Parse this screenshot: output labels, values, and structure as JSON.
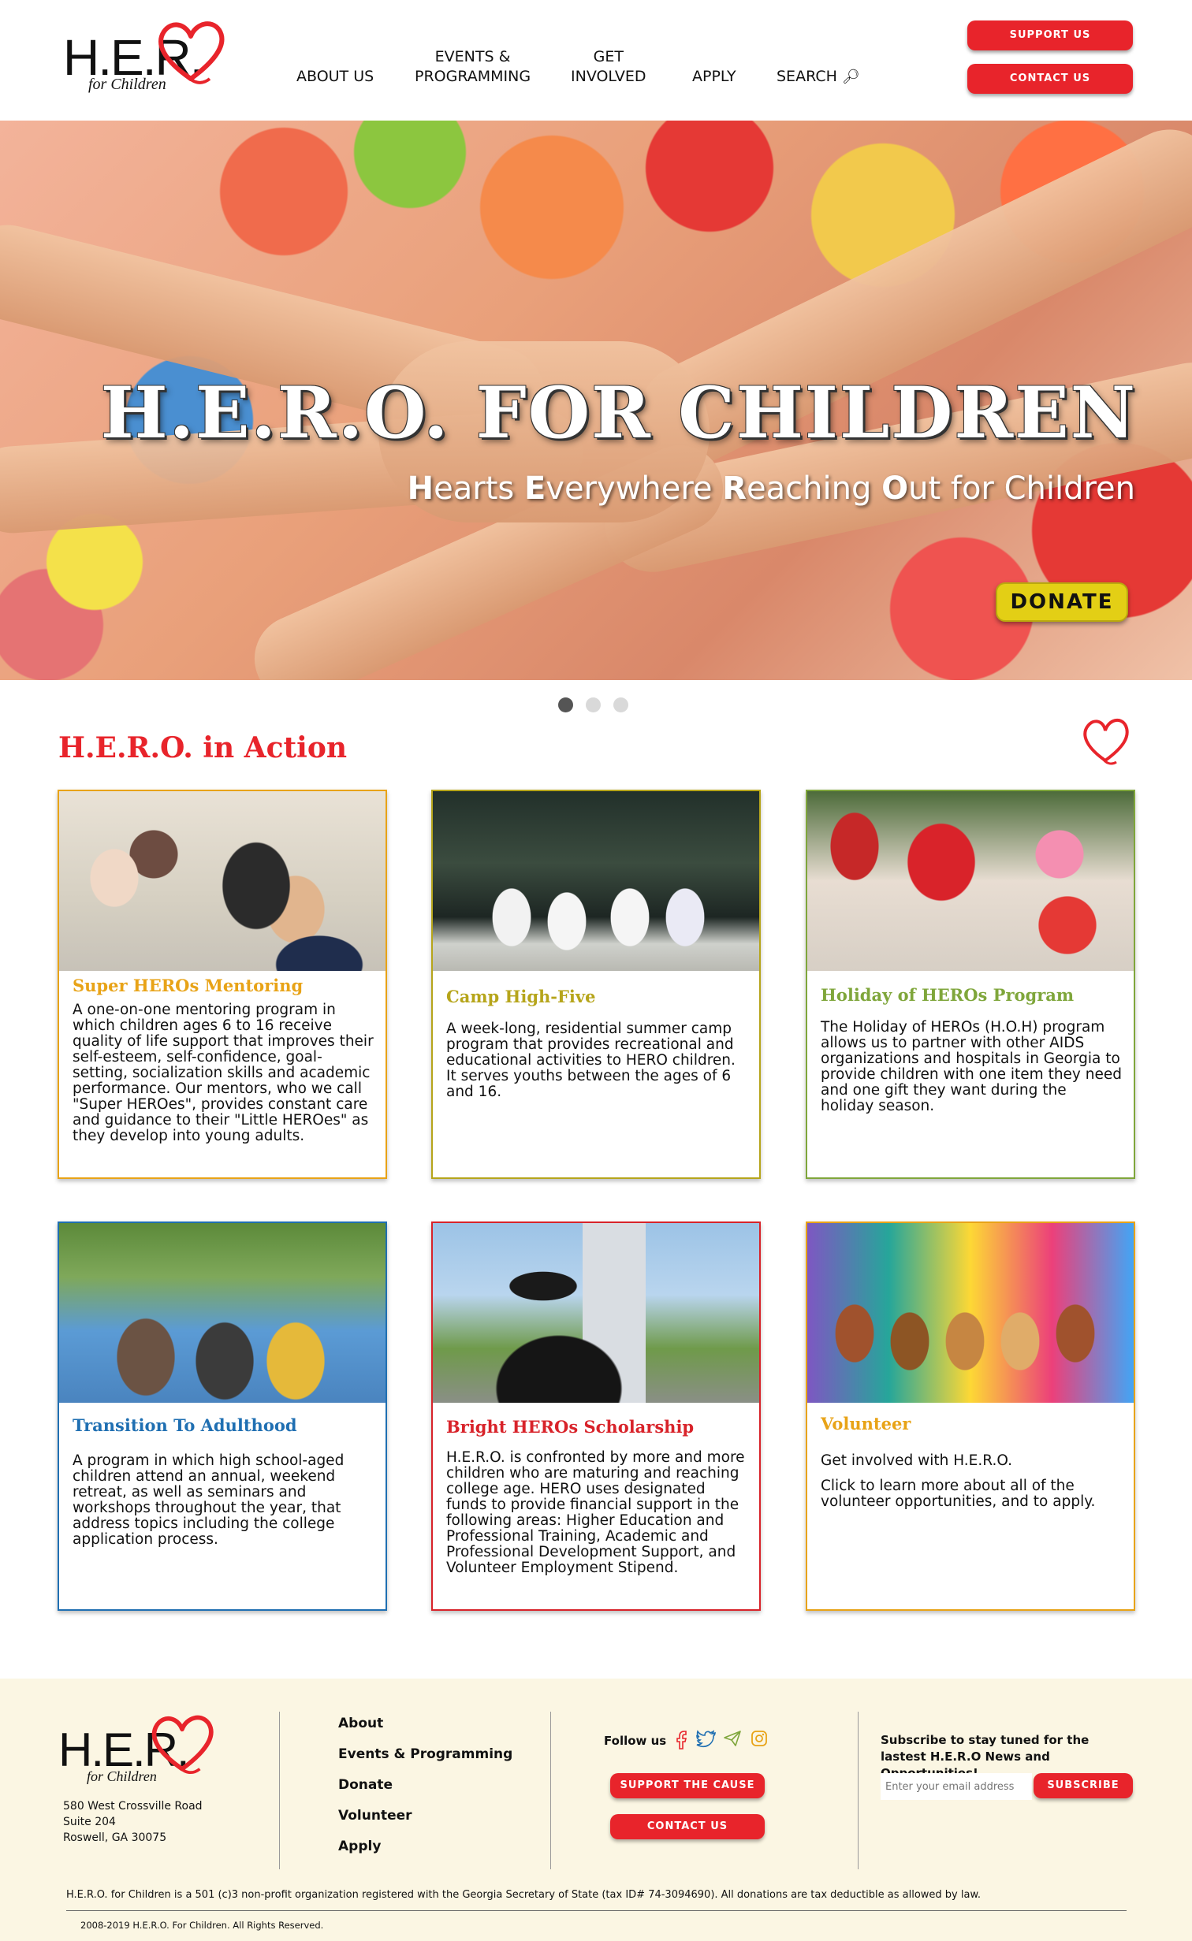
{
  "header": {
    "logo_text": "H.E.R.",
    "logo_sub": "for Children",
    "nav": [
      {
        "line1": "",
        "line2": "ABOUT US"
      },
      {
        "line1": "EVENTS &",
        "line2": "PROGRAMMING"
      },
      {
        "line1": "GET",
        "line2": "INVOLVED"
      },
      {
        "line1": "",
        "line2": "APPLY"
      },
      {
        "line1": "",
        "line2": "SEARCH"
      }
    ],
    "support_label": "SUPPORT US",
    "contact_label": "CONTACT US"
  },
  "hero": {
    "title": "H.E.R.O. FOR CHILDREN",
    "subtitle_parts": [
      {
        "initial": "H",
        "rest": "earts "
      },
      {
        "initial": "E",
        "rest": "verywhere "
      },
      {
        "initial": "R",
        "rest": "eaching "
      },
      {
        "initial": "O",
        "rest": "ut for Children"
      }
    ],
    "donate_label": "DONATE",
    "active_slide": 1,
    "slide_count": 3
  },
  "section": {
    "title": "H.E.R.O. in Action"
  },
  "cards": [
    {
      "title": "Super HEROs Mentoring",
      "color": "#e8a317",
      "text": "A one-on-one mentoring program in which children ages 6 to 16 receive quality of life support that improves their self-esteem, self-confidence, goal-setting, socialization skills and academic performance. Our mentors, who we call \"Super HEROes\", provides constant care and guidance to their \"Little HEROes\" as they develop into young adults."
    },
    {
      "title": "Camp High-Five",
      "color": "#b6a51b",
      "text": "A week-long, residential summer camp program that provides recreational and educational activities to HERO children. It serves youths between the ages of 6 and 16."
    },
    {
      "title": "Holiday of HEROs Program",
      "color": "#7fa63b",
      "text": "The Holiday of HEROs (H.O.H) program allows us to partner with other AIDS organizations and hospitals in Georgia to provide children with one item they need and one gift they want during the holiday season."
    },
    {
      "title": "Transition To Adulthood",
      "color": "#1f6fb2",
      "text": "A program in which high school-aged children attend an annual, weekend retreat, as well as seminars and workshops throughout the year, that address topics including the college application process."
    },
    {
      "title": "Bright HEROs Scholarship",
      "color": "#d8232a",
      "text": "H.E.R.O. is confronted by more and more children who are maturing and reaching college age. HERO uses designated funds to provide financial support in the following areas: Higher Education and Professional Training, Academic and Professional Development Support, and Volunteer Employment Stipend."
    },
    {
      "title": "Volunteer",
      "color": "#e8a317",
      "text": "Get involved with H.E.R.O.",
      "text2": "Click to learn more about all of the volunteer opportunities, and to apply."
    }
  ],
  "footer": {
    "logo_text": "H.E.R.",
    "logo_sub": "for Children",
    "address": [
      "580 West Crossville Road",
      "Suite 204",
      "Roswell, GA 30075"
    ],
    "links": [
      "About",
      "Events & Programming",
      "Donate",
      "Volunteer",
      "Apply"
    ],
    "follow_label": "Follow us",
    "support_cause_label": "SUPPORT THE CAUSE",
    "contact_label": "CONTACT US",
    "subscribe_text": "Subscribe to stay tuned for the lastest H.E.R.O News and Opportunities!",
    "email_placeholder": "Enter your email address",
    "subscribe_label": "SUBSCRIBE",
    "legal": "H.E.R.O. for Children is a 501 (c)3 non-profit organization registered with the Georgia Secretary of State (tax ID# 74-3094690). All donations are tax deductible as allowed by law.",
    "copyright": "2008-2019 H.E.R.O. For Children. All Rights Reserved."
  }
}
